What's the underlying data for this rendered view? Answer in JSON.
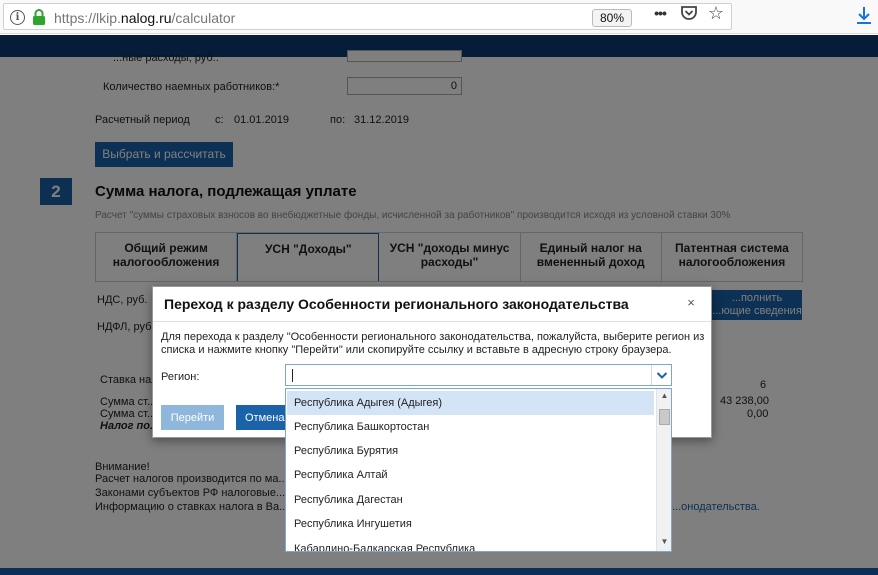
{
  "browser": {
    "url_prefix": "https://lkip.",
    "url_domain": "nalog.ru",
    "url_path": "/calculator",
    "zoom": "80%"
  },
  "page": {
    "row1_label": "...ные расходы, руб.:",
    "row1_value": "...",
    "workers_label": "Количество наемных работников:*",
    "workers_value": "0",
    "period_label": "Расчетный период",
    "period_from_label": "с:",
    "period_from": "01.01.2019",
    "period_to_label": "по:",
    "period_to": "31.12.2019",
    "calc_button": "Выбрать и рассчитать",
    "step_number": "2",
    "section_title": "Сумма налога, подлежащая уплате",
    "section_desc": "Расчет \"суммы страховых взносов во внебюджетные фонды, исчисленной за работников\" производится исходя из условной ставки 30%",
    "tabs": [
      "Общий режим налогообложения",
      "УСН \"Доходы\"",
      "УСН \"доходы минус расходы\"",
      "Единый налог на вмененный доход",
      "Патентная система налогообложения"
    ],
    "vat_label": "НДС, руб.",
    "ndfl_label": "НДФЛ, руб.",
    "fill_button": "...полнить ...ющие сведения",
    "rate_label": "Ставка нало...",
    "rate_value": "6",
    "sum1_label": "Сумма ст...",
    "sum1_value": "43 238,00",
    "sum2_label": "Сумма ст...",
    "sum2_value": "0,00",
    "tax_label": "Налог по...",
    "notice_title": "Внимание!",
    "notice_line1": "Расчет налогов производится по ма...",
    "notice_line2": "Законами субъектов РФ налоговые...",
    "notice_line3": "Информацию о ставках налога в Ва...",
    "notice_link_tail": "...онодательства."
  },
  "modal": {
    "title": "Переход к разделу Особенности регионального законодательства",
    "close": "×",
    "description": "Для перехода к разделу \"Особенности регионального законодательства, пожалуйста, выберите регион из списка и нажмите кнопку \"Перейти\" или скопируйте ссылку и вставьте в адресную строку браузера.",
    "region_label": "Регион:",
    "go_button": "Перейти",
    "cancel_button": "Отмена"
  },
  "dropdown": {
    "options": [
      "Республика Адыгея (Адыгея)",
      "Республика Башкортостан",
      "Республика Бурятия",
      "Республика Алтай",
      "Республика Дагестан",
      "Республика Ингушетия",
      "Кабардино-Балкарская Республика"
    ],
    "highlighted_index": 0
  },
  "colors": {
    "brand_dark": "#0b3b70",
    "button_blue": "#1a63a8",
    "button_disabled": "#8fb6db",
    "option_highlight": "#d4e4f7"
  }
}
